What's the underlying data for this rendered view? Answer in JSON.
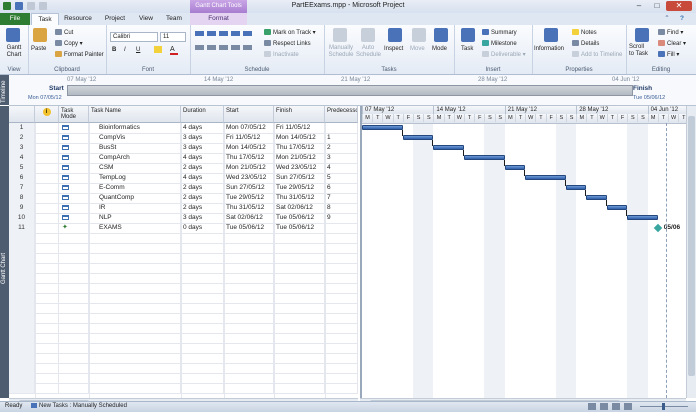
{
  "window": {
    "title": "PartEExams.mpp - Microsoft Project",
    "context_tools": "Gantt Chart Tools"
  },
  "tabs": [
    "File",
    "Task",
    "Resource",
    "Project",
    "View",
    "Team",
    "Format"
  ],
  "ribbon": {
    "view_group": {
      "gantt_label": "Gantt\nChart",
      "label": "View"
    },
    "clipboard": {
      "paste": "Paste",
      "cut": "Cut",
      "copy": "Copy",
      "format_painter": "Format Painter",
      "label": "Clipboard"
    },
    "font": {
      "name": "Calibri",
      "size": "11",
      "bold": "B",
      "italic": "I",
      "underline": "U",
      "label": "Font"
    },
    "schedule": {
      "mark_on_track": "Mark on Track",
      "respect_links": "Respect Links",
      "inactivate": "Inactivate",
      "label": "Schedule"
    },
    "tasks": {
      "manually_schedule": "Manually\nSchedule",
      "auto_schedule": "Auto\nSchedule",
      "inspect": "Inspect",
      "move": "Move",
      "mode": "Mode",
      "label": "Tasks"
    },
    "insert": {
      "task": "Task",
      "summary": "Summary",
      "milestone": "Milestone",
      "deliverable": "Deliverable",
      "label": "Insert"
    },
    "properties": {
      "information": "Information",
      "notes": "Notes",
      "details": "Details",
      "add_to_timeline": "Add to Timeline",
      "label": "Properties"
    },
    "editing": {
      "scroll_to_task": "Scroll\nto Task",
      "find": "Find",
      "clear": "Clear",
      "fill": "Fill",
      "label": "Editing"
    }
  },
  "timeline": {
    "side_label": "Timeline",
    "dates": [
      "07 May '12",
      "14 May '12",
      "21 May '12",
      "28 May '12",
      "04 Jun '12"
    ],
    "start_label": "Start",
    "start_date": "Mon 07/05/12",
    "finish_label": "Finish",
    "finish_date": "Tue 05/06/12"
  },
  "gantt_side_label": "Gantt Chart",
  "table": {
    "headers": {
      "info": "i",
      "mode": "Task\nMode",
      "name": "Task Name",
      "duration": "Duration",
      "start": "Start",
      "finish": "Finish",
      "predecessors": "Predecessors"
    },
    "rows": [
      {
        "id": "1",
        "mode": "manual",
        "name": "Bioinformatics",
        "duration": "4 days",
        "start": "Mon 07/05/12",
        "finish": "Fri 11/05/12",
        "pred": ""
      },
      {
        "id": "2",
        "mode": "manual",
        "name": "CompVis",
        "duration": "3 days",
        "start": "Fri 11/05/12",
        "finish": "Mon 14/05/12",
        "pred": "1"
      },
      {
        "id": "3",
        "mode": "manual",
        "name": "BusSt",
        "duration": "3 days",
        "start": "Mon 14/05/12",
        "finish": "Thu 17/05/12",
        "pred": "2"
      },
      {
        "id": "4",
        "mode": "manual",
        "name": "CompArch",
        "duration": "4 days",
        "start": "Thu 17/05/12",
        "finish": "Mon 21/05/12",
        "pred": "3"
      },
      {
        "id": "5",
        "mode": "manual",
        "name": "CSM",
        "duration": "2 days",
        "start": "Mon 21/05/12",
        "finish": "Wed 23/05/12",
        "pred": "4"
      },
      {
        "id": "6",
        "mode": "manual",
        "name": "TempLog",
        "duration": "4 days",
        "start": "Wed 23/05/12",
        "finish": "Sun 27/05/12",
        "pred": "5"
      },
      {
        "id": "7",
        "mode": "manual",
        "name": "E-Comm",
        "duration": "2 days",
        "start": "Sun 27/05/12",
        "finish": "Tue 29/05/12",
        "pred": "6"
      },
      {
        "id": "8",
        "mode": "manual",
        "name": "QuantComp",
        "duration": "2 days",
        "start": "Tue 29/05/12",
        "finish": "Thu 31/05/12",
        "pred": "7"
      },
      {
        "id": "9",
        "mode": "manual",
        "name": "IR",
        "duration": "2 days",
        "start": "Thu 31/05/12",
        "finish": "Sat 02/06/12",
        "pred": "8"
      },
      {
        "id": "10",
        "mode": "manual",
        "name": "NLP",
        "duration": "3 days",
        "start": "Sat 02/06/12",
        "finish": "Tue 05/06/12",
        "pred": "9"
      },
      {
        "id": "11",
        "mode": "milestone",
        "name": "EXAMS",
        "duration": "0 days",
        "start": "Tue 05/06/12",
        "finish": "Tue 05/06/12",
        "pred": ""
      }
    ]
  },
  "gantt": {
    "weeks": [
      "07 May '12",
      "14 May '12",
      "21 May '12",
      "28 May '12",
      "04 Jun '12"
    ],
    "day_letters": [
      "M",
      "T",
      "W",
      "T",
      "F",
      "S",
      "S"
    ],
    "milestone_label": "05/06"
  },
  "status": {
    "ready": "Ready",
    "new_tasks": "New Tasks : Manually Scheduled"
  },
  "colors": {
    "file_tab": "#2f7d32",
    "bar": "#2f5ea8",
    "milestone": "#3aa6a0",
    "context": "#a77dd0"
  }
}
